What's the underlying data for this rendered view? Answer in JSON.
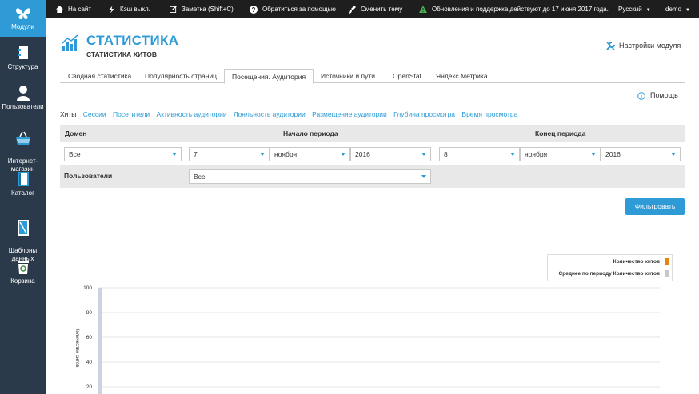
{
  "sidebar": {
    "items": [
      {
        "label": "Модули",
        "icon": "butterfly-icon"
      },
      {
        "label": "Структура",
        "icon": "structure-icon"
      },
      {
        "label": "Пользователи",
        "icon": "user-icon"
      },
      {
        "label": "Интернет-\nмагазин",
        "icon": "basket-icon"
      },
      {
        "label": "Каталог",
        "icon": "book-icon"
      },
      {
        "label": "Шаблоны\nданных",
        "icon": "template-icon"
      },
      {
        "label": "Корзина",
        "icon": "trash-icon"
      }
    ]
  },
  "topbar": {
    "site": "На сайт",
    "cache": "Кэш выкл.",
    "note": "Заметка (Shift+C)",
    "help": "Обратиться за помощью",
    "theme": "Сменить тему",
    "updates": "Обновления и поддержка действуют до 17 июня 2017 года.",
    "language": "Русский",
    "user": "demo"
  },
  "header": {
    "title": "СТАТИСТИКА",
    "subtitle": "СТАТИСТИКА ХИТОВ",
    "settings_label": "Настройки модуля"
  },
  "tabs": [
    {
      "label": "Сводная статистика"
    },
    {
      "label": "Популярность страниц"
    },
    {
      "label": "Посещения. Аудитория",
      "active": true
    },
    {
      "label": "Источники и пути"
    },
    {
      "label": "OpenStat"
    },
    {
      "label": "Яндекс.Метрика"
    }
  ],
  "help_label": "Помощь",
  "subnav": [
    "Хиты",
    "Сессии",
    "Посетители",
    "Активность аудитории",
    "Лояльность аудитории",
    "Размещение аудитории",
    "Глубина просмотра",
    "Время просмотра"
  ],
  "filter": {
    "domain_header": "Домен",
    "start_header": "Начало периода",
    "end_header": "Конец периода",
    "domain_value": "Все",
    "start_day": "7",
    "start_month": "ноября",
    "start_year": "2016",
    "end_day": "8",
    "end_month": "ноября",
    "end_year": "2016",
    "users_label": "Пользователи",
    "users_value": "Все",
    "submit_label": "Фильтровать"
  },
  "chart_data": {
    "type": "bar",
    "ylabel": "Количество хитов",
    "ylim": [
      0,
      100
    ],
    "yticks": [
      "100",
      "80",
      "60",
      "40",
      "20"
    ],
    "series": [
      {
        "name": "Количество хитов",
        "color": "#e8820c"
      },
      {
        "name": "Среднее по периоду Количество хитов",
        "color": "#c8c8c8"
      }
    ],
    "grid": true,
    "legend": "top-right"
  },
  "colors": {
    "accent": "#2e9bd6",
    "sidebar": "#2b3a4a",
    "topbar": "#1e1e1e"
  }
}
